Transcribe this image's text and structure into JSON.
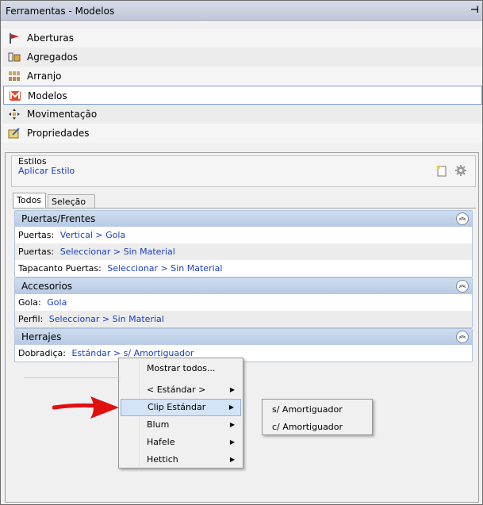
{
  "window": {
    "title": "Ferramentas - Modelos",
    "pin_glyph": "⊣"
  },
  "nav": [
    {
      "label": "Aberturas",
      "icon": "aberturas-icon"
    },
    {
      "label": "Agregados",
      "icon": "agregados-icon"
    },
    {
      "label": "Arranjo",
      "icon": "arranjo-icon"
    },
    {
      "label": "Modelos",
      "icon": "modelos-icon"
    },
    {
      "label": "Movimentação",
      "icon": "movimentacao-icon"
    },
    {
      "label": "Propriedades",
      "icon": "propriedades-icon"
    }
  ],
  "styles": {
    "label": "Estilos",
    "apply_label": "Aplicar Estilo"
  },
  "tabs": {
    "todos": "Todos",
    "selecao": "Seleção"
  },
  "groups": {
    "puertas": {
      "title": "Puertas/Frentes",
      "rows": [
        {
          "label": "Puertas:",
          "value": "Vertical > Gola"
        },
        {
          "label": "Puertas:",
          "value": "Seleccionar > Sin Material"
        },
        {
          "label": "Tapacanto Puertas:",
          "value": "Seleccionar > Sin Material"
        }
      ]
    },
    "accesorios": {
      "title": "Accesorios",
      "rows": [
        {
          "label": "Gola:",
          "value": "Gola"
        },
        {
          "label": "Perfil:",
          "value": "Seleccionar > Sin Material"
        }
      ]
    },
    "herrajes": {
      "title": "Herrajes",
      "rows": [
        {
          "label": "Dobradiça:",
          "value": "Estándar > s/ Amortiguador"
        }
      ]
    }
  },
  "context_menu": {
    "items": {
      "mostrar": "Mostrar todos...",
      "estandar": "< Estándar >",
      "clip": "Clip Estándar",
      "blum": "Blum",
      "hafele": "Hafele",
      "hettich": "Hettich"
    },
    "submenu": {
      "s_amort": "s/ Amortiguador",
      "c_amort": "c/ Amortiguador"
    }
  },
  "colors": {
    "link": "#1a3fc6",
    "group_header": "#c3d3ea",
    "menu_highlight": "#d4e4f8",
    "arrow_red": "#e01010"
  }
}
